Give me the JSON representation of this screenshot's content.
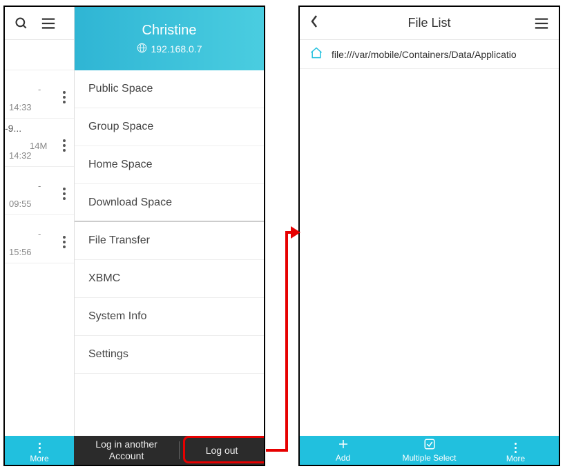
{
  "left": {
    "partial_rows": [
      {
        "clip": "",
        "size": "",
        "dash": "-",
        "time": "14:33"
      },
      {
        "clip": "-9...",
        "size": "14M",
        "dash": "",
        "time": "14:32"
      },
      {
        "clip": "",
        "size": "",
        "dash": "-",
        "time": "09:55"
      },
      {
        "clip": "",
        "size": "",
        "dash": "-",
        "time": "15:56"
      }
    ],
    "drawer": {
      "name": "Christine",
      "ip": "192.168.0.7",
      "items_group1": [
        "Public Space",
        "Group Space",
        "Home Space",
        "Download Space"
      ],
      "items_group2": [
        "File Transfer",
        "XBMC",
        "System Info",
        "Settings"
      ]
    },
    "bottom": {
      "more": "More",
      "login_another": "Log in another\nAccount",
      "logout": "Log out"
    }
  },
  "right": {
    "title": "File List",
    "path": "file:///var/mobile/Containers/Data/Applicatio",
    "bottom": {
      "add": "Add",
      "multiselect": "Multiple Select",
      "more": "More"
    }
  }
}
